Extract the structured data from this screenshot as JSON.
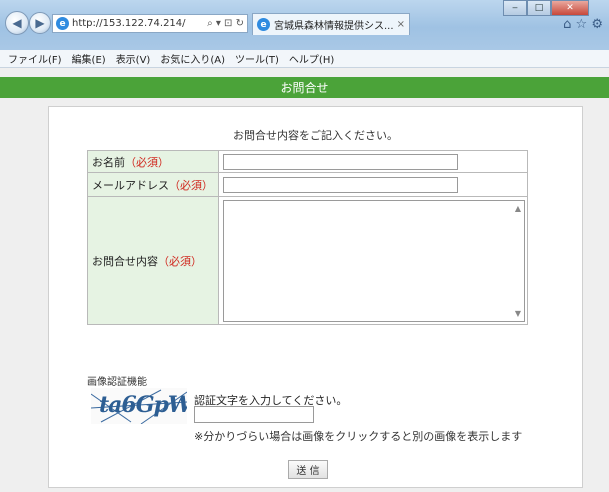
{
  "browser": {
    "address": "http://153.122.74.214/",
    "address_icons": "⌕ ▾ ⊡ ↻",
    "tab_title": "宮城県森林情報提供シス...",
    "tab_close": "×",
    "toolbar_icons": "⌂ ☆ ⚙",
    "window_buttons": {
      "minimize": "‒",
      "maximize": "□",
      "close": "✕"
    }
  },
  "menubar": {
    "items": [
      "ファイル(F)",
      "編集(E)",
      "表示(V)",
      "お気に入り(A)",
      "ツール(T)",
      "ヘルプ(H)"
    ]
  },
  "page": {
    "header": "お問合せ",
    "intro": "お問合せ内容をご記入ください。",
    "required_mark": "（必須）",
    "fields": [
      {
        "label": "お名前",
        "value": ""
      },
      {
        "label": "メールアドレス",
        "value": ""
      },
      {
        "label": "お問合せ内容",
        "value": ""
      }
    ],
    "captcha": {
      "heading": "画像認証機能",
      "image_text": "ta6GpW",
      "prompt": "認証文字を入力してください。",
      "value": "",
      "note": "※分かりづらい場合は画像をクリックすると別の画像を表示します"
    },
    "submit_label": "送 信"
  },
  "colors": {
    "header_green": "#4ba339",
    "label_bg": "#e6f3e3",
    "required_red": "#d0261d"
  }
}
